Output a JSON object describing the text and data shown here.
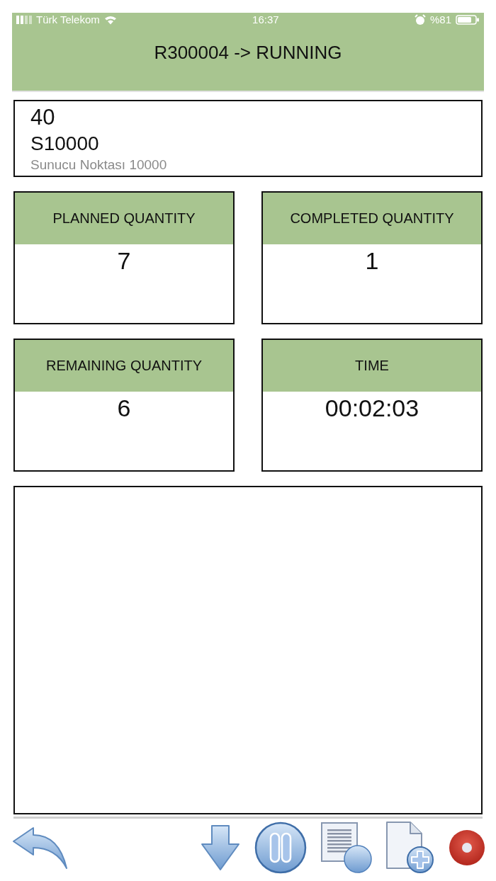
{
  "status_bar": {
    "carrier": "Türk Telekom",
    "time": "16:37",
    "battery": "%81"
  },
  "header": {
    "title": "R300004 -> RUNNING"
  },
  "operation": {
    "number": "40",
    "code": "S10000",
    "description": "Sunucu Noktası 10000"
  },
  "metrics": [
    {
      "label": "PLANNED QUANTITY",
      "value": "7"
    },
    {
      "label": "COMPLETED QUANTITY",
      "value": "1"
    },
    {
      "label": "REMAINING QUANTITY",
      "value": "6"
    },
    {
      "label": "TIME",
      "value": "00:02:03"
    }
  ],
  "toolbar": [
    {
      "kind": "back"
    },
    {
      "kind": "down"
    },
    {
      "kind": "pause"
    },
    {
      "kind": "report"
    },
    {
      "kind": "new"
    },
    {
      "kind": "stop"
    }
  ]
}
